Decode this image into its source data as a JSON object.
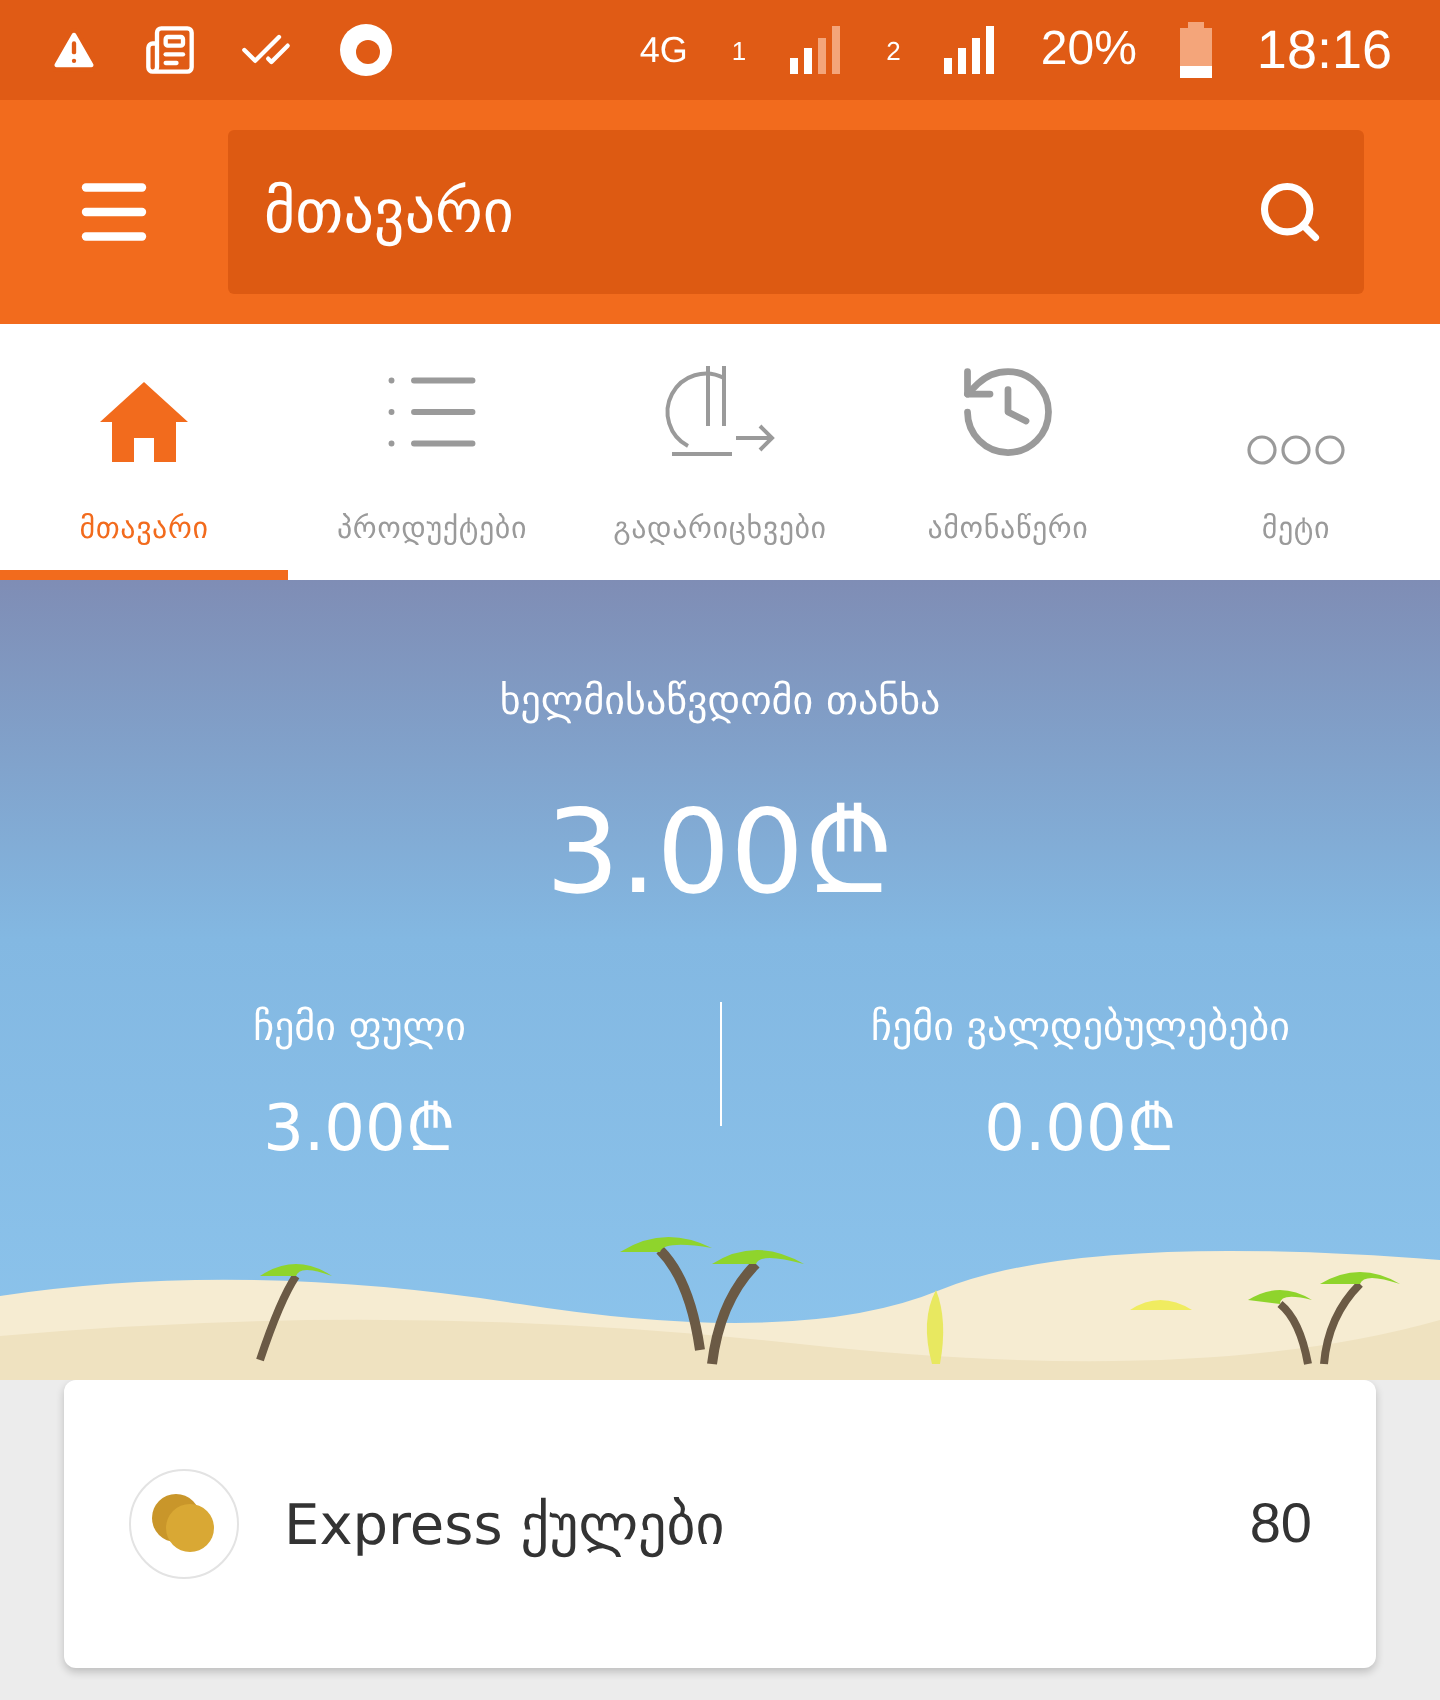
{
  "status_bar": {
    "network": "4G",
    "sim_1": "1",
    "sim_2": "2",
    "battery": "20%",
    "time": "18:16"
  },
  "app_bar": {
    "title": "მთავარი"
  },
  "tabs": [
    {
      "label": "მთავარი",
      "selected": true,
      "kind": "home"
    },
    {
      "label": "პროდუქტები",
      "selected": false,
      "kind": "list"
    },
    {
      "label": "გადარიცხვები",
      "selected": false,
      "kind": "transfer"
    },
    {
      "label": "ამონაწერი",
      "selected": false,
      "kind": "history"
    },
    {
      "label": "მეტი",
      "selected": false,
      "kind": "more"
    }
  ],
  "balance": {
    "label": "ხელმისაწვდომი თანხა",
    "amount": "3.00₾",
    "columns": [
      {
        "label": "ჩემი ფული",
        "amount": "3.00₾"
      },
      {
        "label": "ჩემი ვალდებულებები",
        "amount": "0.00₾"
      }
    ]
  },
  "bonus_card": {
    "label": "Express ქულები",
    "value": "80"
  }
}
